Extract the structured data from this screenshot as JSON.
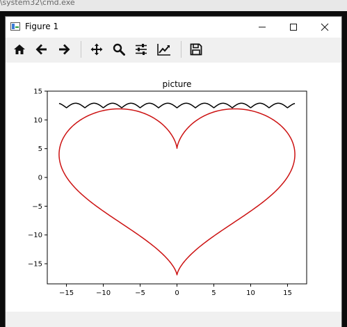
{
  "background_window": {
    "path_fragment": "s\\system32\\cmd.exe"
  },
  "window": {
    "title": "Figure 1",
    "controls": {
      "minimize": "—",
      "maximize": "☐",
      "close": "✕"
    }
  },
  "toolbar": {
    "buttons": [
      "home-icon",
      "back-icon",
      "forward-icon",
      "pan-icon",
      "zoom-icon",
      "configure-subplots-icon",
      "edit-axis-icon",
      "save-icon"
    ]
  },
  "colors": {
    "heart": "#cc1111",
    "wave": "#000000",
    "toolbar_bg": "#f0f0f0"
  },
  "chart_data": {
    "type": "line",
    "title": "picture",
    "xlabel": "",
    "ylabel": "",
    "xlim": [
      -17.6,
      17.6
    ],
    "ylim": [
      -18.5,
      15.0
    ],
    "xticks": [
      -15,
      -10,
      -5,
      0,
      5,
      10,
      15
    ],
    "yticks": [
      15,
      10,
      5,
      0,
      -5,
      -10,
      -15
    ],
    "xtick_labels": [
      "−15",
      "−10",
      "−5",
      "0",
      "5",
      "10",
      "15"
    ],
    "ytick_labels": [
      "15",
      "10",
      "5",
      "0",
      "−5",
      "−10",
      "−15"
    ],
    "grid": false,
    "series": [
      {
        "color": "#cc1111",
        "equation": "x = 16 sin^3(t), y = 13 cos(t) - 5 cos(2t) - 2 cos(3t) - cos(4t)"
      },
      {
        "color": "#000000",
        "x_range": [
          -16,
          16
        ],
        "equation": "y = 12.5 + 0.8 |cos(x*pi/2.5)| roughly; scalloped wave",
        "baseline": 12.5,
        "amplitude": 0.8
      }
    ]
  }
}
